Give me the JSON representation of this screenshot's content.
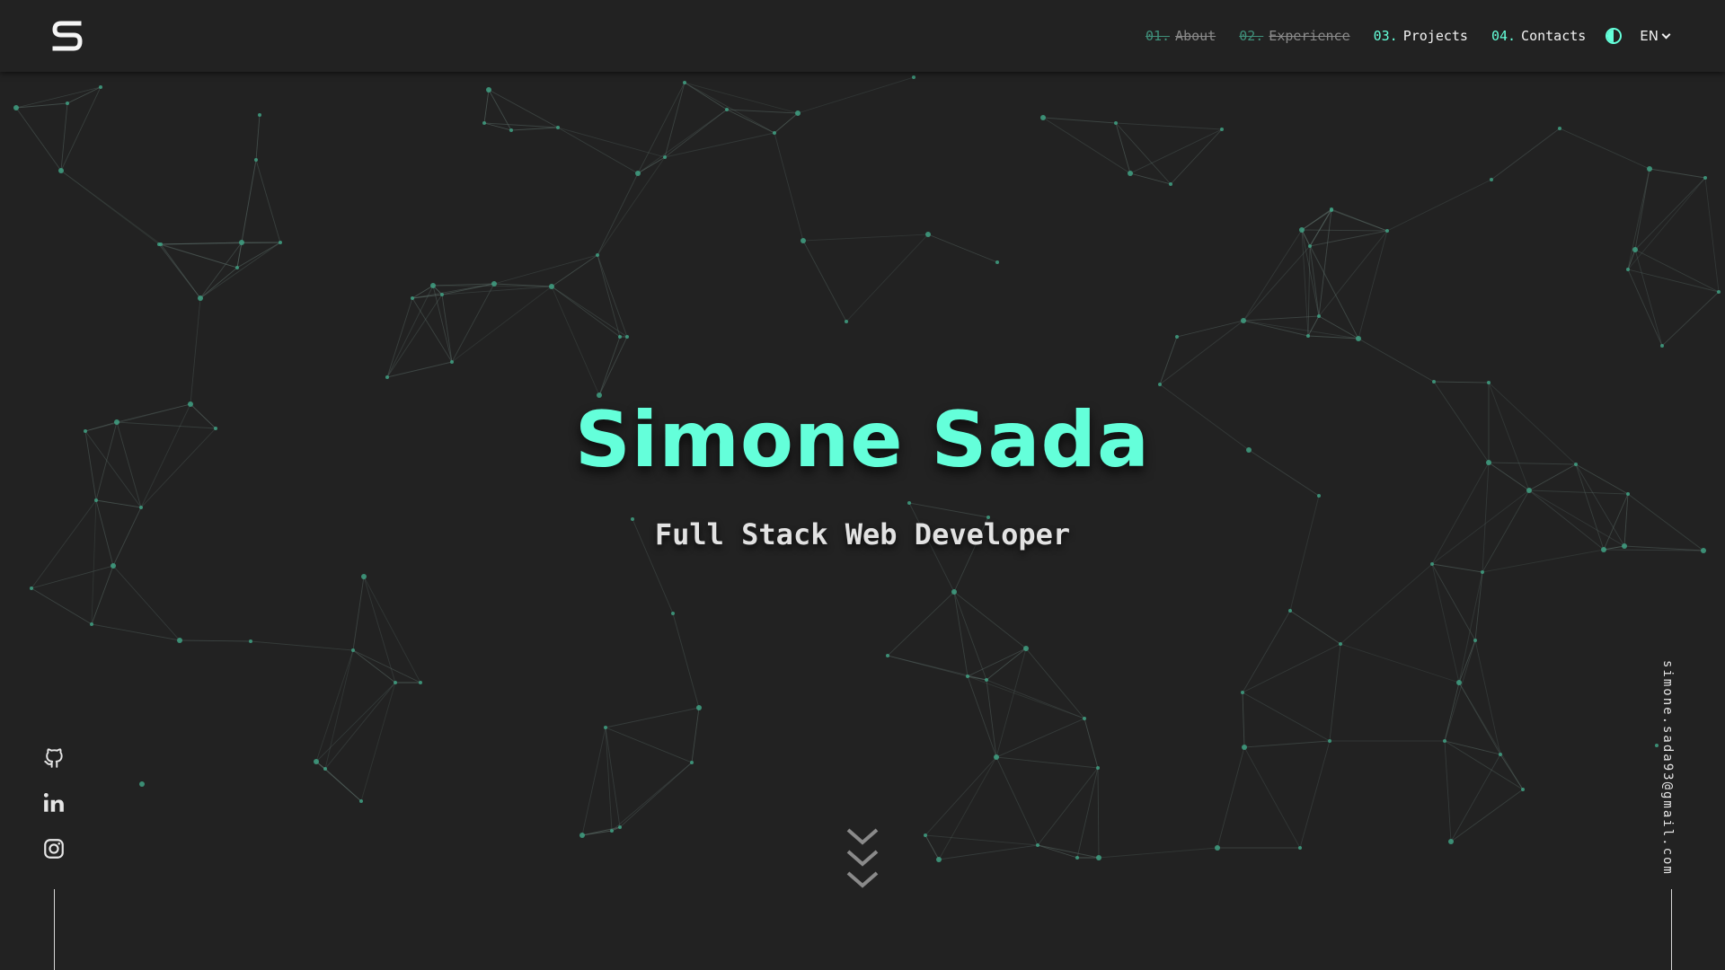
{
  "brand": {
    "logo_letter": "S"
  },
  "nav": {
    "items": [
      {
        "num": "01.",
        "label": "About",
        "visited": true
      },
      {
        "num": "02.",
        "label": "Experience",
        "visited": true
      },
      {
        "num": "03.",
        "label": "Projects",
        "visited": false
      },
      {
        "num": "04.",
        "label": "Contacts",
        "visited": false
      }
    ],
    "theme_icon": "contrast-icon",
    "language": "EN"
  },
  "hero": {
    "name": "Simone Sada",
    "role": "Full Stack Web Developer"
  },
  "social": {
    "icons": [
      "github-icon",
      "linkedin-icon",
      "instagram-icon"
    ]
  },
  "email": "simone.sada93@gmail.com",
  "colors": {
    "background": "#222222",
    "accent": "#64ffda",
    "text": "#e6e6e6"
  }
}
